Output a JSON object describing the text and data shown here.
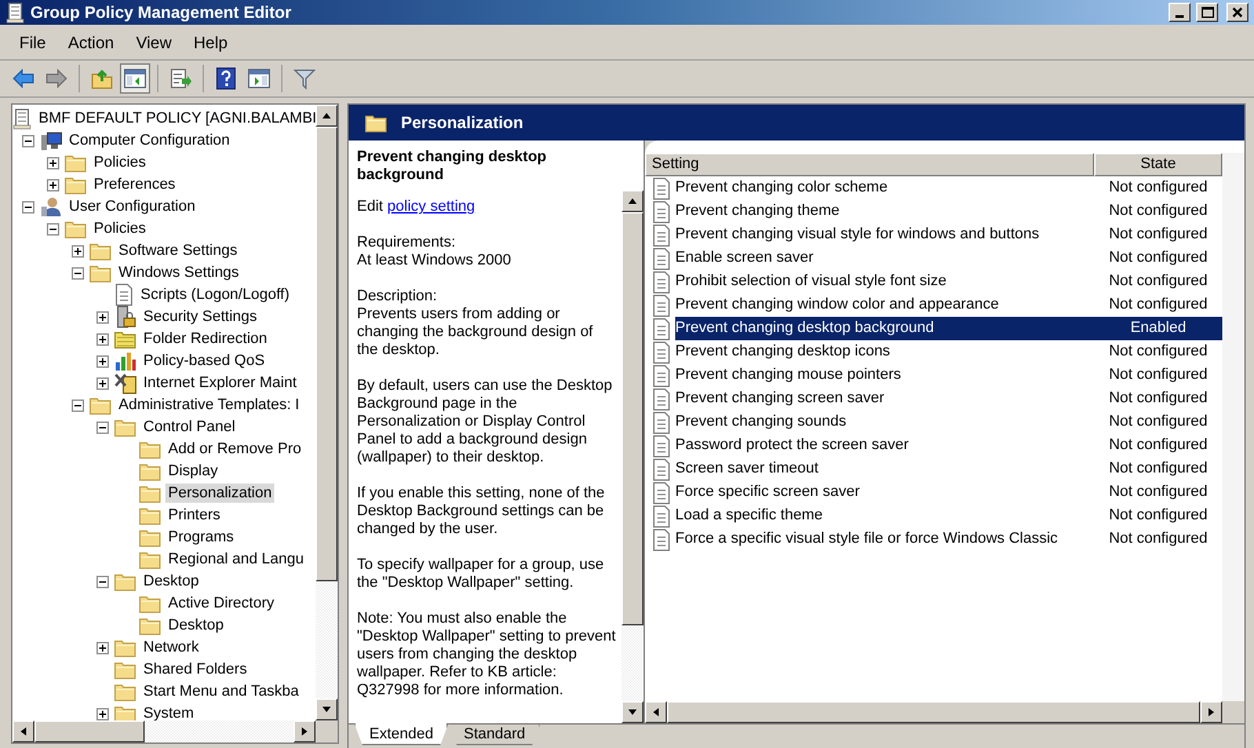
{
  "window": {
    "title": "Group Policy Management Editor"
  },
  "menu": [
    "File",
    "Action",
    "View",
    "Help"
  ],
  "toolbar": [
    {
      "kind": "back",
      "pressed": false
    },
    {
      "kind": "forward",
      "pressed": false
    },
    {
      "kind": "up",
      "pressed": false
    },
    {
      "kind": "tree",
      "pressed": true
    },
    {
      "kind": "export",
      "pressed": false
    },
    {
      "kind": "help",
      "pressed": false
    },
    {
      "kind": "pane",
      "pressed": false
    },
    {
      "kind": "filter",
      "pressed": false
    }
  ],
  "tree": {
    "label": "BMF DEFAULT POLICY [AGNI.BALAMBI",
    "kind": "policy",
    "selected": false,
    "children": [
      {
        "label": "Computer Configuration",
        "kind": "computer",
        "selected": false,
        "expanded": true,
        "children": [
          {
            "label": "Policies",
            "kind": "folder",
            "selected": false,
            "expanded": false
          },
          {
            "label": "Preferences",
            "kind": "folder",
            "selected": false,
            "expanded": false
          }
        ]
      },
      {
        "label": "User Configuration",
        "kind": "user",
        "selected": false,
        "expanded": true,
        "children": [
          {
            "label": "Policies",
            "kind": "folder",
            "selected": false,
            "expanded": true,
            "children": [
              {
                "label": "Software Settings",
                "kind": "folder",
                "selected": false,
                "expanded": false
              },
              {
                "label": "Windows Settings",
                "kind": "folder",
                "selected": false,
                "expanded": true,
                "children": [
                  {
                    "label": "Scripts (Logon/Logoff)",
                    "kind": "scripts",
                    "selected": false
                  },
                  {
                    "label": "Security Settings",
                    "kind": "security",
                    "selected": false,
                    "expanded": false
                  },
                  {
                    "label": "Folder Redirection",
                    "kind": "redirect",
                    "selected": false,
                    "expanded": false
                  },
                  {
                    "label": "Policy-based QoS",
                    "kind": "qos",
                    "selected": false,
                    "expanded": false
                  },
                  {
                    "label": "Internet Explorer Maint",
                    "kind": "ie",
                    "selected": false,
                    "expanded": false
                  }
                ]
              },
              {
                "label": "Administrative Templates: I",
                "kind": "folder",
                "selected": false,
                "expanded": true,
                "children": [
                  {
                    "label": "Control Panel",
                    "kind": "folder",
                    "selected": false,
                    "expanded": true,
                    "children": [
                      {
                        "label": "Add or Remove Pro",
                        "kind": "folder",
                        "selected": false
                      },
                      {
                        "label": "Display",
                        "kind": "folder",
                        "selected": false
                      },
                      {
                        "label": "Personalization",
                        "kind": "folder",
                        "selected": true
                      },
                      {
                        "label": "Printers",
                        "kind": "folder",
                        "selected": false
                      },
                      {
                        "label": "Programs",
                        "kind": "folder",
                        "selected": false
                      },
                      {
                        "label": "Regional and Langu",
                        "kind": "folder",
                        "selected": false
                      }
                    ]
                  },
                  {
                    "label": "Desktop",
                    "kind": "folder",
                    "selected": false,
                    "expanded": true,
                    "children": [
                      {
                        "label": "Active Directory",
                        "kind": "folder",
                        "selected": false
                      },
                      {
                        "label": "Desktop",
                        "kind": "folder",
                        "selected": false
                      }
                    ]
                  },
                  {
                    "label": "Network",
                    "kind": "folder",
                    "selected": false,
                    "expanded": false
                  },
                  {
                    "label": "Shared Folders",
                    "kind": "folder",
                    "selected": false
                  },
                  {
                    "label": "Start Menu and Taskba",
                    "kind": "folder",
                    "selected": false
                  },
                  {
                    "label": "System",
                    "kind": "folder",
                    "selected": false,
                    "expanded": false
                  }
                ]
              }
            ]
          }
        ]
      }
    ]
  },
  "header": {
    "title": "Personalization"
  },
  "description": {
    "title": "Prevent changing desktop background",
    "edit_prefix": "Edit",
    "edit_link": "policy setting",
    "requirements_label": "Requirements:",
    "requirements": "At least Windows 2000",
    "description_label": "Description:",
    "paragraphs": [
      "Prevents users from adding or changing the background design of the desktop.",
      "By default, users can use the Desktop Background page in the Personalization or Display Control Panel to add a background design (wallpaper) to their desktop.",
      "If you enable this setting, none of the Desktop Background settings can be changed by the user.",
      "To specify wallpaper for a group, use the \"Desktop Wallpaper\" setting.",
      "Note: You must also enable the \"Desktop Wallpaper\" setting to prevent users from changing the desktop wallpaper. Refer to KB article: Q327998 for more information."
    ]
  },
  "table": {
    "columns": [
      "Setting",
      "State"
    ],
    "rows": [
      {
        "setting": "Prevent changing color scheme",
        "state": "Not configured",
        "selected": false
      },
      {
        "setting": "Prevent changing theme",
        "state": "Not configured",
        "selected": false
      },
      {
        "setting": "Prevent changing visual style for windows and buttons",
        "state": "Not configured",
        "selected": false
      },
      {
        "setting": "Enable screen saver",
        "state": "Not configured",
        "selected": false
      },
      {
        "setting": "Prohibit selection of visual style font size",
        "state": "Not configured",
        "selected": false
      },
      {
        "setting": "Prevent changing window color and appearance",
        "state": "Not configured",
        "selected": false
      },
      {
        "setting": "Prevent changing desktop background",
        "state": "Enabled",
        "selected": true
      },
      {
        "setting": "Prevent changing desktop icons",
        "state": "Not configured",
        "selected": false
      },
      {
        "setting": "Prevent changing mouse pointers",
        "state": "Not configured",
        "selected": false
      },
      {
        "setting": "Prevent changing screen saver",
        "state": "Not configured",
        "selected": false
      },
      {
        "setting": "Prevent changing sounds",
        "state": "Not configured",
        "selected": false
      },
      {
        "setting": "Password protect the screen saver",
        "state": "Not configured",
        "selected": false
      },
      {
        "setting": "Screen saver timeout",
        "state": "Not configured",
        "selected": false
      },
      {
        "setting": "Force specific screen saver",
        "state": "Not configured",
        "selected": false
      },
      {
        "setting": "Load a specific theme",
        "state": "Not configured",
        "selected": false
      },
      {
        "setting": "Force a specific visual style file or force Windows Classic",
        "state": "Not configured",
        "selected": false
      }
    ]
  },
  "view_tabs": [
    {
      "label": "Extended",
      "selected": true
    },
    {
      "label": "Standard",
      "selected": false
    }
  ]
}
